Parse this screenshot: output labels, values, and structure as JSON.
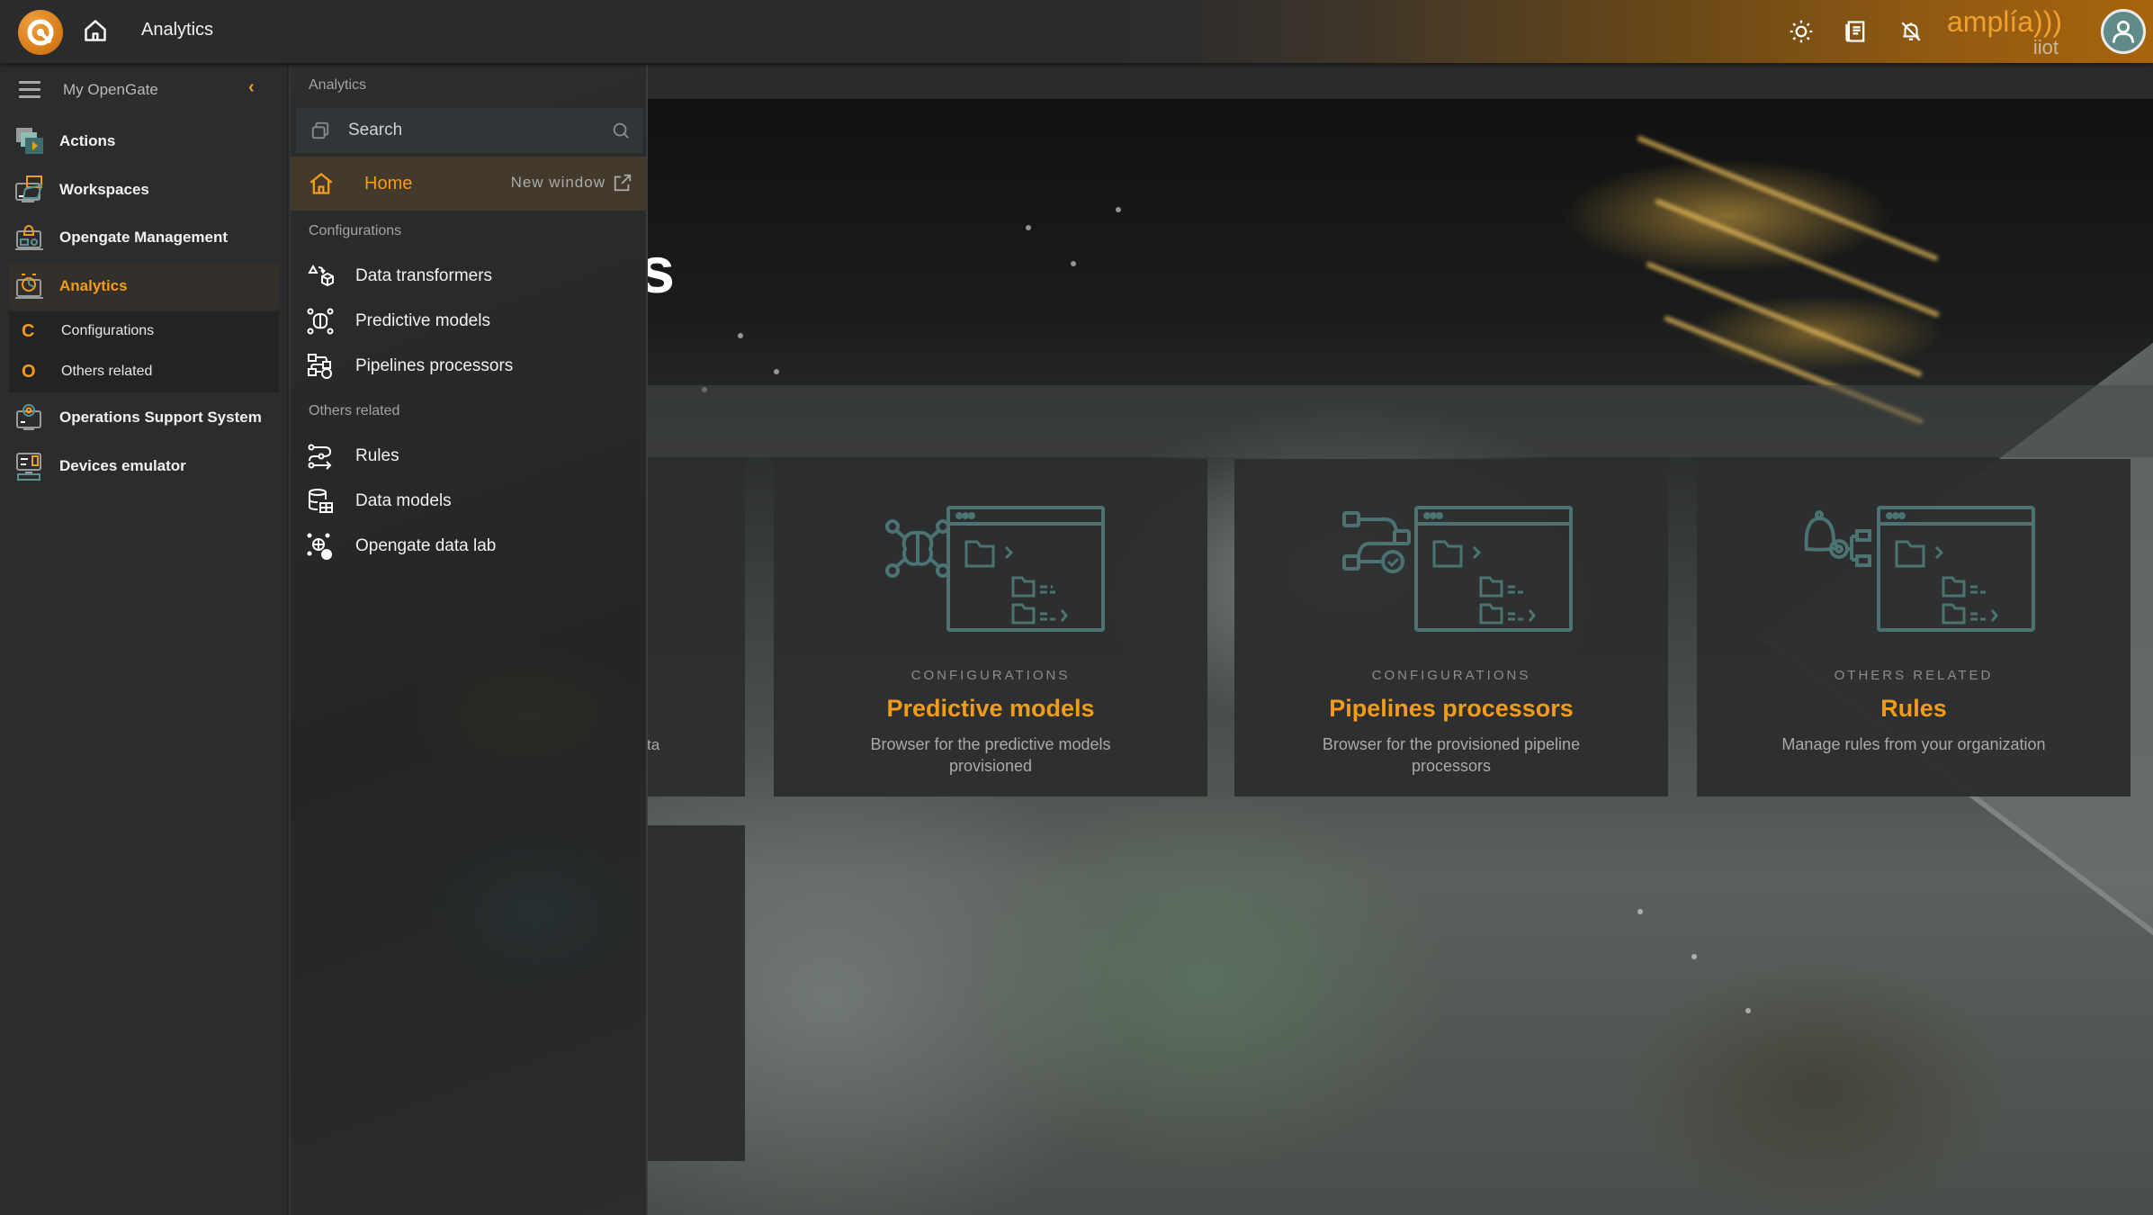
{
  "header": {
    "title": "Analytics",
    "brand_main": "amplía)))",
    "brand_sub": "iiot",
    "icons": [
      "logo-icon",
      "home-icon",
      "theme-sun-icon",
      "documentation-icon",
      "notifications-off-icon",
      "user-avatar-icon"
    ]
  },
  "sidebar": {
    "title": "My OpenGate",
    "items": [
      {
        "label": "Actions",
        "icon": "actions-icon"
      },
      {
        "label": "Workspaces",
        "icon": "workspaces-icon"
      },
      {
        "label": "Opengate Management",
        "icon": "opengate-management-icon"
      },
      {
        "label": "Analytics",
        "icon": "analytics-icon",
        "active": true
      },
      {
        "label": "Operations Support System",
        "icon": "operations-support-icon"
      },
      {
        "label": "Devices emulator",
        "icon": "devices-emulator-icon"
      }
    ],
    "subitems": [
      {
        "letter": "C",
        "label": "Configurations"
      },
      {
        "letter": "O",
        "label": "Others related"
      }
    ]
  },
  "flyout": {
    "section_title": "Analytics",
    "search_placeholder": "Search",
    "home_label": "Home",
    "new_window_label": "New window",
    "groups": [
      {
        "title": "Configurations",
        "items": [
          {
            "label": "Data transformers",
            "icon": "data-transformers-icon"
          },
          {
            "label": "Predictive models",
            "icon": "predictive-models-icon"
          },
          {
            "label": "Pipelines processors",
            "icon": "pipelines-processors-icon"
          }
        ]
      },
      {
        "title": "Others related",
        "items": [
          {
            "label": "Rules",
            "icon": "rules-icon"
          },
          {
            "label": "Data models",
            "icon": "data-models-icon"
          },
          {
            "label": "Opengate data lab",
            "icon": "opengate-data-lab-icon"
          }
        ]
      }
    ]
  },
  "main": {
    "hero_title_partial": "cs",
    "partial_card_text": "ta",
    "cards": [
      {
        "category": "CONFIGURATIONS",
        "title": "Predictive models",
        "description": "Browser for the predictive models provisioned"
      },
      {
        "category": "CONFIGURATIONS",
        "title": "Pipelines processors",
        "description": "Browser for the provisioned pipeline processors"
      },
      {
        "category": "OTHERS RELATED",
        "title": "Rules",
        "description": "Manage rules from your organization"
      }
    ]
  },
  "colors": {
    "accent": "#f29c19",
    "illustration": "#4a7371",
    "sidebar_bg": "#2b2c2e",
    "active_bg": "#443a2b"
  }
}
